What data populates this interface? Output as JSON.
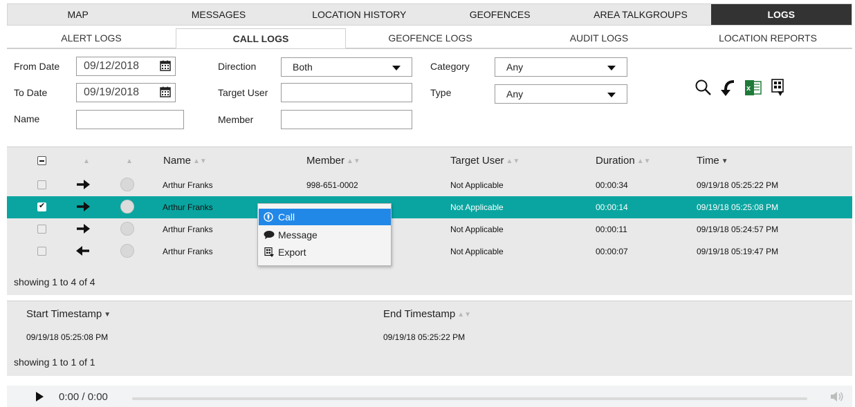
{
  "top_tabs": [
    {
      "label": "MAP"
    },
    {
      "label": "MESSAGES"
    },
    {
      "label": "LOCATION HISTORY"
    },
    {
      "label": "GEOFENCES"
    },
    {
      "label": "AREA TALKGROUPS"
    },
    {
      "label": "LOGS"
    }
  ],
  "sub_tabs": [
    {
      "label": "ALERT LOGS"
    },
    {
      "label": "CALL LOGS"
    },
    {
      "label": "GEOFENCE LOGS"
    },
    {
      "label": "AUDIT LOGS"
    },
    {
      "label": "LOCATION REPORTS"
    }
  ],
  "filters": {
    "from_date_label": "From Date",
    "from_date_value": "09/12/2018",
    "to_date_label": "To Date",
    "to_date_value": "09/19/2018",
    "name_label": "Name",
    "name_value": "",
    "direction_label": "Direction",
    "direction_value": "Both",
    "target_user_label": "Target User",
    "target_user_value": "",
    "member_label": "Member",
    "member_value": "",
    "category_label": "Category",
    "category_value": "Any",
    "type_label": "Type",
    "type_value": "Any"
  },
  "actions": [
    "search-icon",
    "back-icon",
    "excel-export-icon",
    "pdf-export-icon"
  ],
  "call_table": {
    "columns": {
      "name": "Name",
      "member": "Member",
      "target_user": "Target User",
      "duration": "Duration",
      "time": "Time"
    },
    "rows": [
      {
        "name": "Arthur Franks",
        "member": "998-651-0002",
        "target_user": "Not Applicable",
        "duration": "00:00:34",
        "time": "09/19/18 05:25:22 PM",
        "direction": "outgoing",
        "checked": false
      },
      {
        "name": "Arthur Franks",
        "member": "",
        "target_user": "Not Applicable",
        "duration": "00:00:14",
        "time": "09/19/18 05:25:08 PM",
        "direction": "outgoing",
        "checked": true
      },
      {
        "name": "Arthur Franks",
        "member": "",
        "target_user": "Not Applicable",
        "duration": "00:00:11",
        "time": "09/19/18 05:24:57 PM",
        "direction": "outgoing",
        "checked": false
      },
      {
        "name": "Arthur Franks",
        "member": "",
        "target_user": "Not Applicable",
        "duration": "00:00:07",
        "time": "09/19/18 05:19:47 PM",
        "direction": "incoming",
        "checked": false
      }
    ],
    "footer": "showing 1 to 4 of 4"
  },
  "context_menu": {
    "items": [
      {
        "label": "Call",
        "icon": "call-icon"
      },
      {
        "label": "Message",
        "icon": "message-icon"
      },
      {
        "label": "Export",
        "icon": "export-icon"
      }
    ]
  },
  "timestamp_table": {
    "columns": {
      "start": "Start Timestamp",
      "end": "End Timestamp"
    },
    "rows": [
      {
        "start": "09/19/18 05:25:08 PM",
        "end": "09/19/18 05:25:22 PM"
      }
    ],
    "footer": "showing 1 to 1 of 1"
  },
  "player": {
    "time": "0:00 / 0:00",
    "progress": 0
  },
  "colors": {
    "selected_row": "#0aa5a0",
    "menu_highlight": "#2288e8",
    "active_tab": "#333333"
  }
}
